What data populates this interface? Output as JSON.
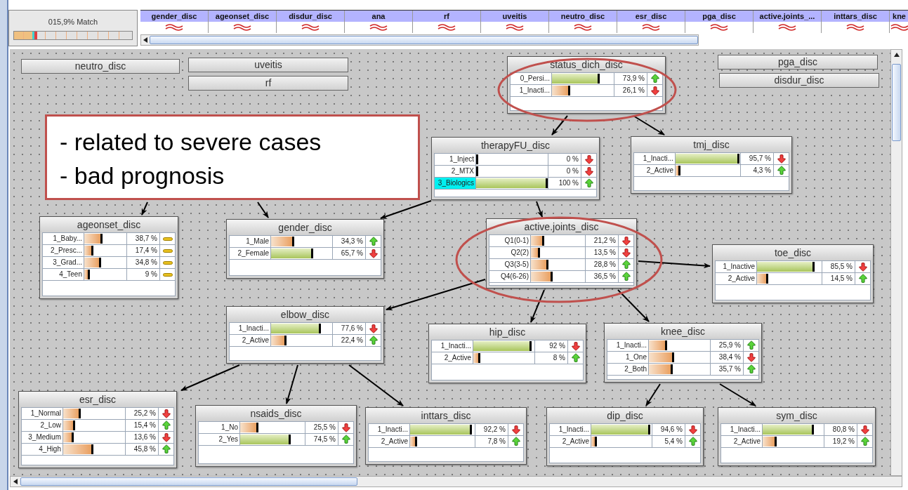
{
  "match": {
    "label": "015,9% Match"
  },
  "columns": [
    {
      "label": "gender_disc"
    },
    {
      "label": "ageonset_disc"
    },
    {
      "label": "disdur_disc"
    },
    {
      "label": "ana"
    },
    {
      "label": "rf"
    },
    {
      "label": "uveitis"
    },
    {
      "label": "neutro_disc"
    },
    {
      "label": "esr_disc"
    },
    {
      "label": "pga_disc"
    },
    {
      "label": "active.joints_..."
    },
    {
      "label": "inttars_disc"
    },
    {
      "label": "kne"
    }
  ],
  "collapsed_nodes": [
    {
      "title": "neutro_disc"
    },
    {
      "title": "uveitis"
    },
    {
      "title": "rf"
    },
    {
      "title": "pga_disc"
    },
    {
      "title": "disdur_disc"
    }
  ],
  "nodes": [
    {
      "title": "status_dich_disc",
      "states": [
        {
          "label": "0_Persi...",
          "level": 0.739,
          "reading": "73,9 %",
          "kind": "up",
          "selected": false
        },
        {
          "label": "1_Inacti...",
          "level": 0.261,
          "reading": "26,1 %",
          "kind": "down",
          "selected": false
        }
      ]
    },
    {
      "title": "therapyFU_disc",
      "states": [
        {
          "label": "1_Inject",
          "level": 0,
          "reading": "0 %",
          "kind": "down",
          "selected": false
        },
        {
          "label": "2_MTX",
          "level": 0,
          "reading": "0 %",
          "kind": "down",
          "selected": false
        },
        {
          "label": "3_Biologics",
          "level": 1,
          "reading": "100 %",
          "kind": "up",
          "selected": true
        }
      ]
    },
    {
      "title": "tmj_disc",
      "states": [
        {
          "label": "1_Inacti...",
          "level": 0.957,
          "reading": "95,7 %",
          "kind": "down",
          "selected": false
        },
        {
          "label": "2_Active",
          "level": 0.043,
          "reading": "4,3 %",
          "kind": "up",
          "selected": false
        }
      ]
    },
    {
      "title": "ageonset_disc",
      "states": [
        {
          "label": "1_Baby...",
          "level": 0.387,
          "reading": "38,7 %",
          "kind": "flat",
          "selected": false
        },
        {
          "label": "2_Presc...",
          "level": 0.174,
          "reading": "17,4 %",
          "kind": "flat",
          "selected": false
        },
        {
          "label": "3_Grad...",
          "level": 0.348,
          "reading": "34,8 %",
          "kind": "flat",
          "selected": false
        },
        {
          "label": "4_Teen",
          "level": 0.09,
          "reading": "9 %",
          "kind": "flat",
          "selected": false
        }
      ]
    },
    {
      "title": "gender_disc",
      "states": [
        {
          "label": "1_Male",
          "level": 0.343,
          "reading": "34,3 %",
          "kind": "up",
          "selected": false
        },
        {
          "label": "2_Female",
          "level": 0.657,
          "reading": "65,7 %",
          "kind": "down",
          "selected": false
        }
      ]
    },
    {
      "title": "active.joints_disc",
      "states": [
        {
          "label": "Q1(0-1)",
          "level": 0.212,
          "reading": "21,2 %",
          "kind": "down",
          "selected": false
        },
        {
          "label": "Q2(2)",
          "level": 0.135,
          "reading": "13,5 %",
          "kind": "down",
          "selected": false
        },
        {
          "label": "Q3(3-5)",
          "level": 0.288,
          "reading": "28,8 %",
          "kind": "up",
          "selected": false
        },
        {
          "label": "Q4(6-26)",
          "level": 0.365,
          "reading": "36,5 %",
          "kind": "up",
          "selected": false
        }
      ]
    },
    {
      "title": "toe_disc",
      "states": [
        {
          "label": "1_Inactive",
          "level": 0.855,
          "reading": "85,5 %",
          "kind": "down",
          "selected": false
        },
        {
          "label": "2_Active",
          "level": 0.145,
          "reading": "14,5 %",
          "kind": "up",
          "selected": false
        }
      ]
    },
    {
      "title": "elbow_disc",
      "states": [
        {
          "label": "1_Inacti...",
          "level": 0.776,
          "reading": "77,6 %",
          "kind": "down",
          "selected": false
        },
        {
          "label": "2_Active",
          "level": 0.224,
          "reading": "22,4 %",
          "kind": "up",
          "selected": false
        }
      ]
    },
    {
      "title": "hip_disc",
      "states": [
        {
          "label": "1_Inacti...",
          "level": 0.92,
          "reading": "92 %",
          "kind": "down",
          "selected": false
        },
        {
          "label": "2_Active",
          "level": 0.08,
          "reading": "8 %",
          "kind": "up",
          "selected": false
        }
      ]
    },
    {
      "title": "knee_disc",
      "states": [
        {
          "label": "1_Inacti...",
          "level": 0.259,
          "reading": "25,9 %",
          "kind": "up",
          "selected": false
        },
        {
          "label": "1_One",
          "level": 0.384,
          "reading": "38,4 %",
          "kind": "down",
          "selected": false
        },
        {
          "label": "2_Both",
          "level": 0.357,
          "reading": "35,7 %",
          "kind": "up",
          "selected": false
        }
      ]
    },
    {
      "title": "esr_disc",
      "states": [
        {
          "label": "1_Normal",
          "level": 0.252,
          "reading": "25,2 %",
          "kind": "down",
          "selected": false
        },
        {
          "label": "2_Low",
          "level": 0.154,
          "reading": "15,4 %",
          "kind": "up",
          "selected": false
        },
        {
          "label": "3_Medium",
          "level": 0.136,
          "reading": "13,6 %",
          "kind": "down",
          "selected": false
        },
        {
          "label": "4_High",
          "level": 0.458,
          "reading": "45,8 %",
          "kind": "up",
          "selected": false
        }
      ]
    },
    {
      "title": "nsaids_disc",
      "states": [
        {
          "label": "1_No",
          "level": 0.255,
          "reading": "25,5 %",
          "kind": "down",
          "selected": false
        },
        {
          "label": "2_Yes",
          "level": 0.745,
          "reading": "74,5 %",
          "kind": "up",
          "selected": false
        }
      ]
    },
    {
      "title": "inttars_disc",
      "states": [
        {
          "label": "1_Inacti...",
          "level": 0.922,
          "reading": "92,2 %",
          "kind": "down",
          "selected": false
        },
        {
          "label": "2_Active",
          "level": 0.078,
          "reading": "7,8 %",
          "kind": "up",
          "selected": false
        }
      ]
    },
    {
      "title": "dip_disc",
      "states": [
        {
          "label": "1_Inacti...",
          "level": 0.946,
          "reading": "94,6 %",
          "kind": "down",
          "selected": false
        },
        {
          "label": "2_Active",
          "level": 0.054,
          "reading": "5,4 %",
          "kind": "up",
          "selected": false
        }
      ]
    },
    {
      "title": "sym_disc",
      "states": [
        {
          "label": "1_Inacti...",
          "level": 0.808,
          "reading": "80,8 %",
          "kind": "down",
          "selected": false
        },
        {
          "label": "2_Active",
          "level": 0.192,
          "reading": "19,2 %",
          "kind": "up",
          "selected": false
        }
      ]
    }
  ],
  "callout": {
    "lines": [
      "- related to severe cases",
      "- bad prognosis"
    ]
  }
}
